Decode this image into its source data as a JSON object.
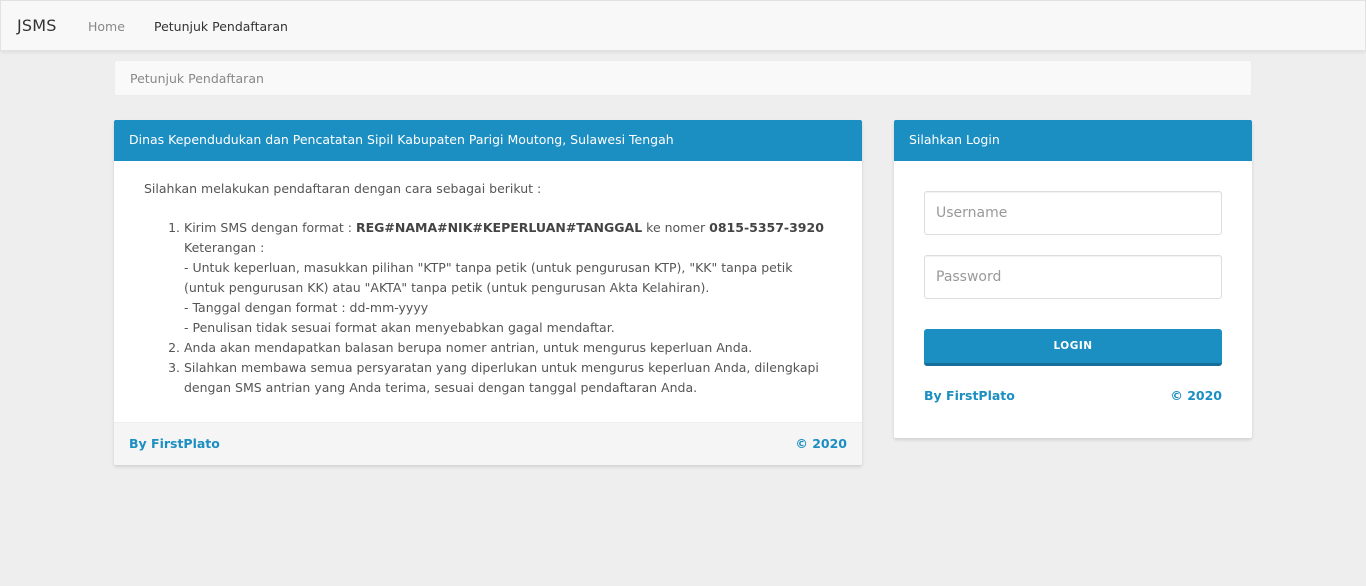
{
  "navbar": {
    "brand": "JSMS",
    "items": [
      {
        "label": "Home"
      },
      {
        "label": "Petunjuk Pendaftaran"
      }
    ]
  },
  "breadcrumb": {
    "current": "Petunjuk Pendaftaran"
  },
  "info_panel": {
    "heading": "Dinas Kependudukan dan Pencatatan Sipil Kabupaten Parigi Moutong, Sulawesi Tengah",
    "intro": "Silahkan melakukan pendaftaran dengan cara sebagai berikut :",
    "step1": {
      "prefix": "Kirim SMS dengan format : ",
      "format": "REG#NAMA#NIK#KEPERLUAN#TANGGAL",
      "middle": " ke nomer ",
      "number": "0815-5357-3920",
      "keterangan_label": "Keterangan :",
      "notes": [
        "- Untuk keperluan, masukkan pilihan \"KTP\" tanpa petik (untuk pengurusan KTP), \"KK\" tanpa petik (untuk pengurusan KK) atau \"AKTA\" tanpa petik (untuk pengurusan Akta Kelahiran).",
        "- Tanggal dengan format : dd-mm-yyyy",
        "- Penulisan tidak sesuai format akan menyebabkan gagal mendaftar."
      ]
    },
    "step2": "Anda akan mendapatkan balasan berupa nomer antrian, untuk mengurus keperluan Anda.",
    "step3": "Silahkan membawa semua persyaratan yang diperlukan untuk mengurus keperluan Anda, dilengkapi dengan SMS antrian yang Anda terima, sesuai dengan tanggal pendaftaran Anda.",
    "footer": {
      "by": "By FirstPlato",
      "copyright": "© 2020"
    }
  },
  "login_panel": {
    "heading": "Silahkan Login",
    "username": {
      "placeholder": "Username",
      "value": ""
    },
    "password": {
      "placeholder": "Password",
      "value": ""
    },
    "button_label": "LOGIN",
    "footer": {
      "by": "By FirstPlato",
      "copyright": "© 2020"
    }
  },
  "colors": {
    "primary": "#1b8ec2",
    "background": "#eeeeee"
  }
}
